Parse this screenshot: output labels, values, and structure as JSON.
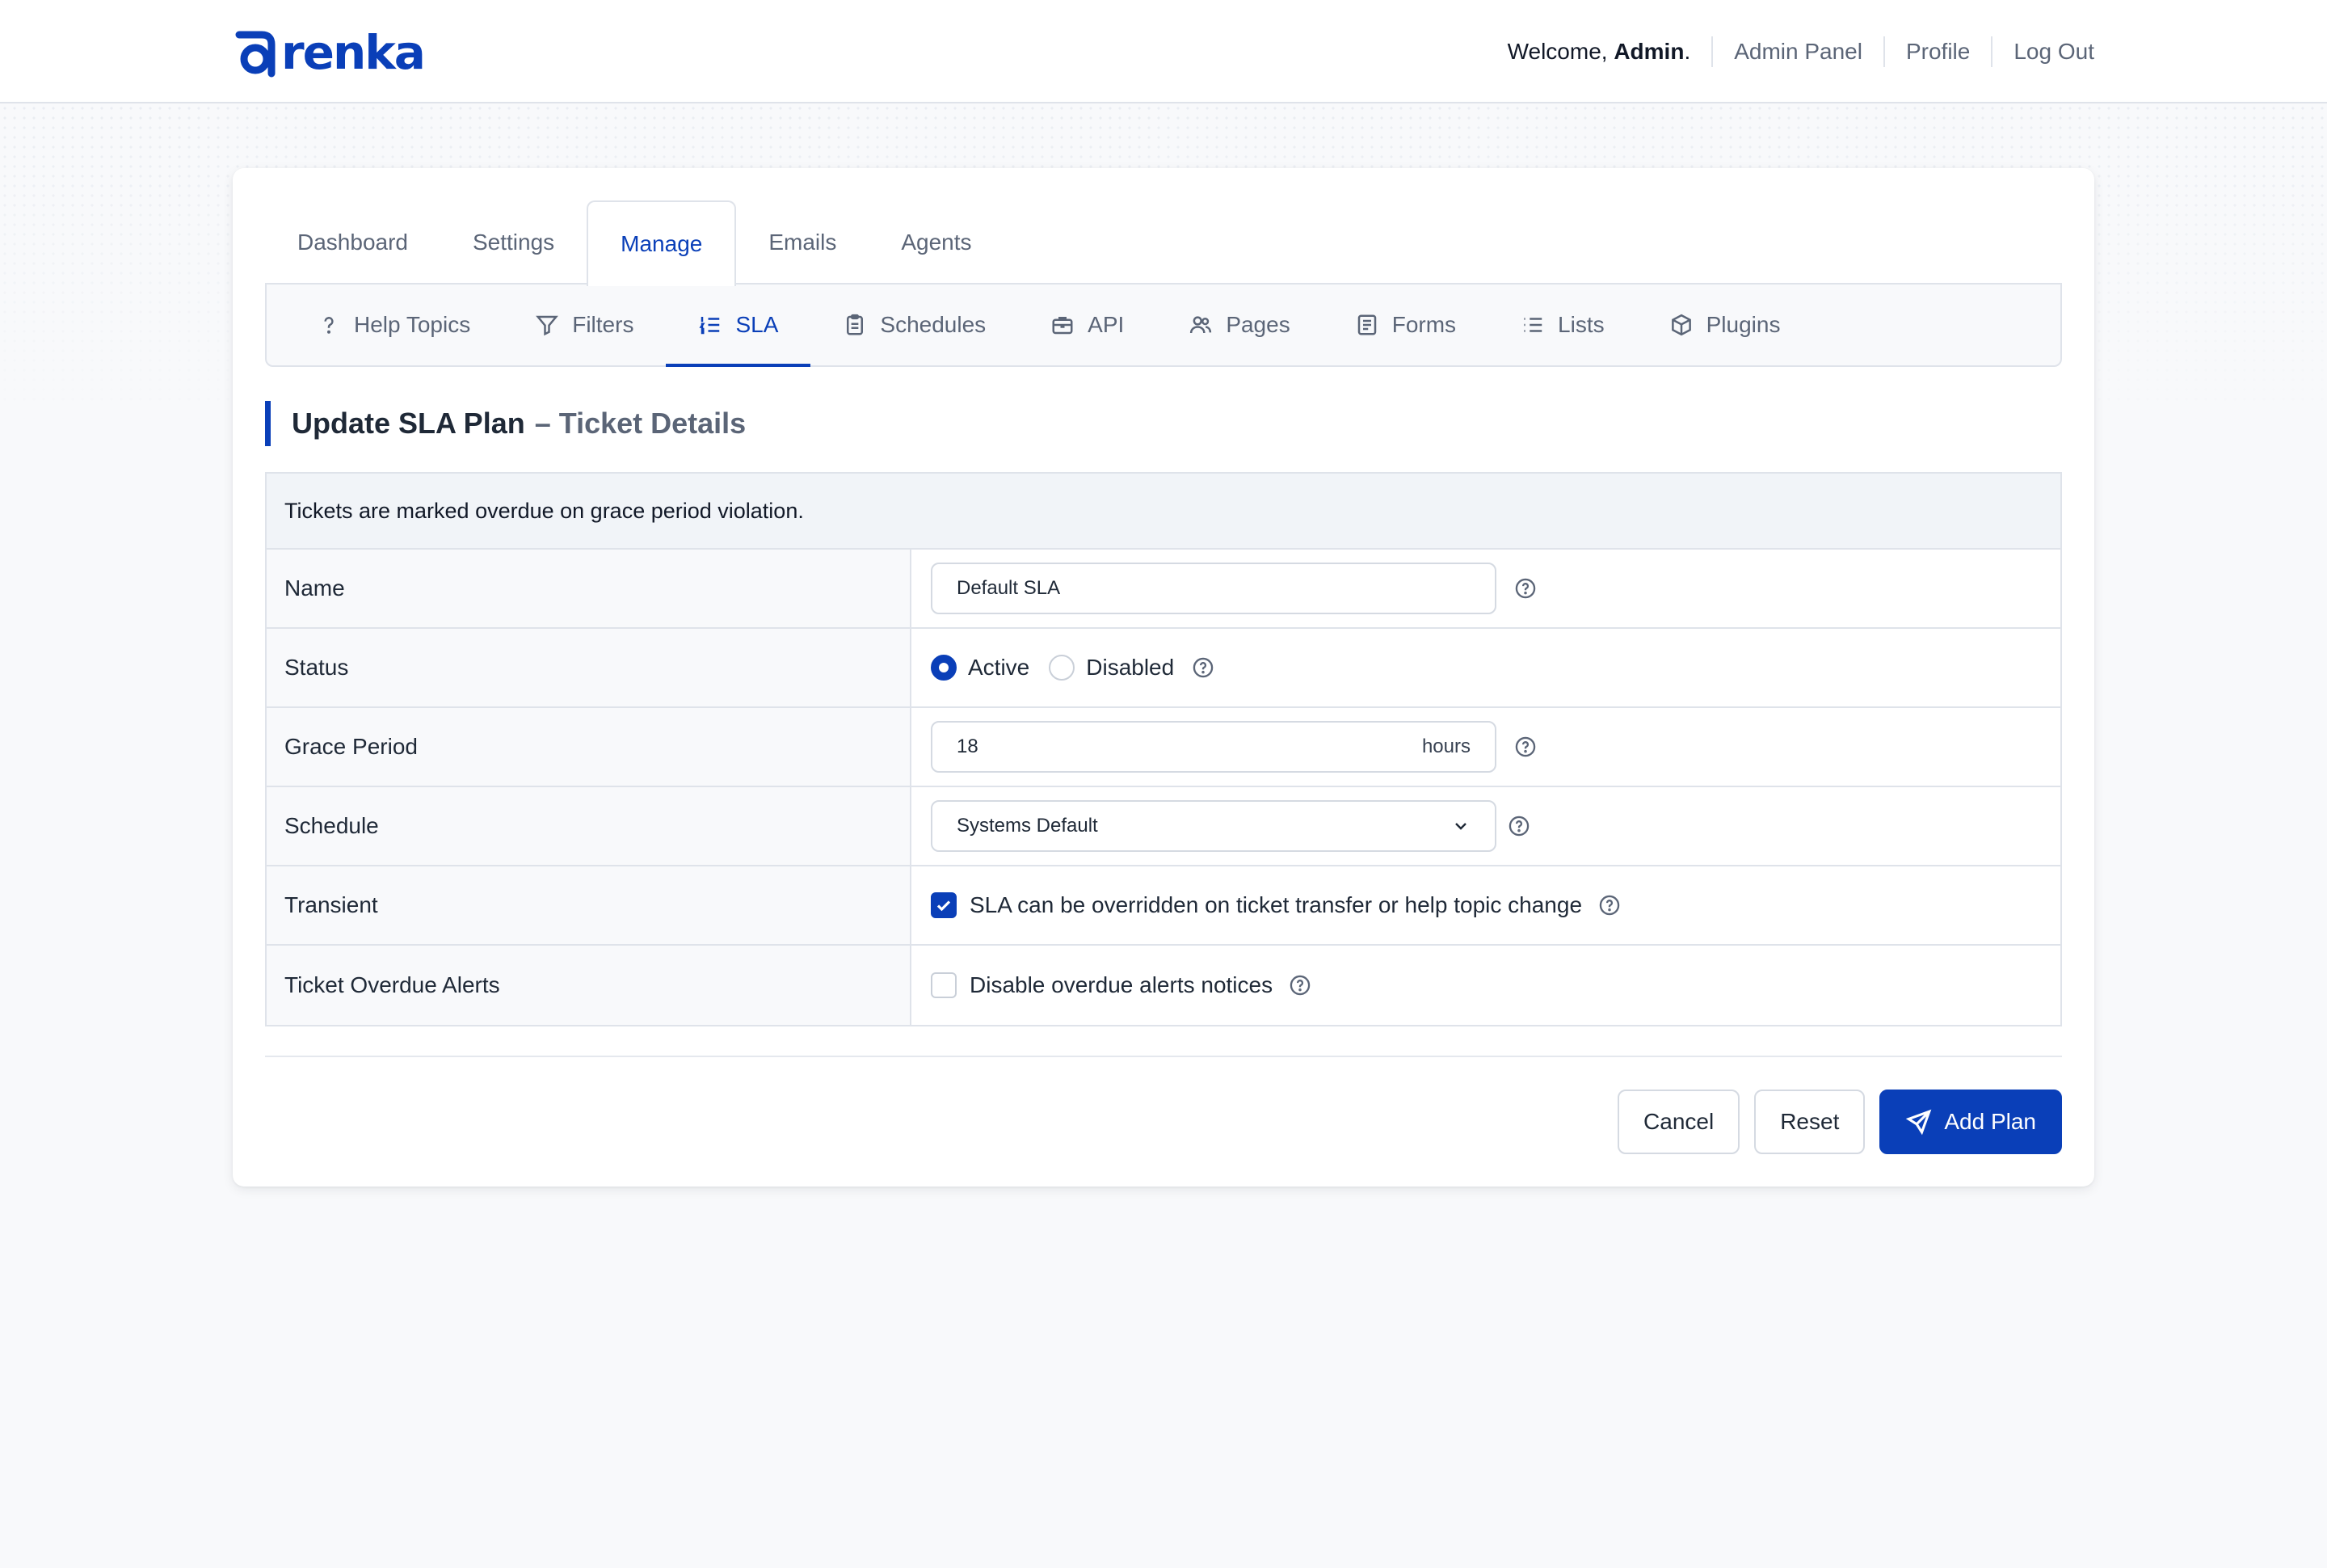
{
  "brand": {
    "logo_text": "renka",
    "color": "#0a3fb8"
  },
  "header": {
    "welcome_prefix": "Welcome,",
    "welcome_user": "Admin",
    "welcome_suffix": ".",
    "links": [
      "Admin Panel",
      "Profile",
      "Log Out"
    ]
  },
  "tabs": [
    {
      "label": "Dashboard",
      "active": false
    },
    {
      "label": "Settings",
      "active": false
    },
    {
      "label": "Manage",
      "active": true
    },
    {
      "label": "Emails",
      "active": false
    },
    {
      "label": "Agents",
      "active": false
    }
  ],
  "subnav": [
    {
      "label": "Help Topics",
      "icon": "question-icon"
    },
    {
      "label": "Filters",
      "icon": "filter-icon"
    },
    {
      "label": "SLA",
      "icon": "list-ordered-icon",
      "active": true
    },
    {
      "label": "Schedules",
      "icon": "clipboard-icon"
    },
    {
      "label": "API",
      "icon": "briefcase-icon"
    },
    {
      "label": "Pages",
      "icon": "users-icon"
    },
    {
      "label": "Forms",
      "icon": "document-icon"
    },
    {
      "label": "Lists",
      "icon": "list-icon"
    },
    {
      "label": "Plugins",
      "icon": "cube-icon"
    }
  ],
  "page": {
    "title": "Update SLA Plan",
    "subtitle": "– Ticket Details"
  },
  "form": {
    "notice": "Tickets are marked overdue on grace period violation.",
    "name": {
      "label": "Name",
      "value": "Default SLA"
    },
    "status": {
      "label": "Status",
      "options": [
        "Active",
        "Disabled"
      ],
      "selected": "Active"
    },
    "grace": {
      "label": "Grace Period",
      "value": "18",
      "unit": "hours"
    },
    "schedule": {
      "label": "Schedule",
      "value": "Systems Default"
    },
    "transient": {
      "label": "Transient",
      "text": "SLA can be overridden on ticket transfer or help topic change",
      "checked": true
    },
    "overdue": {
      "label": "Ticket Overdue Alerts",
      "text": "Disable overdue alerts notices",
      "checked": false
    }
  },
  "actions": {
    "cancel": "Cancel",
    "reset": "Reset",
    "submit": "Add Plan"
  }
}
